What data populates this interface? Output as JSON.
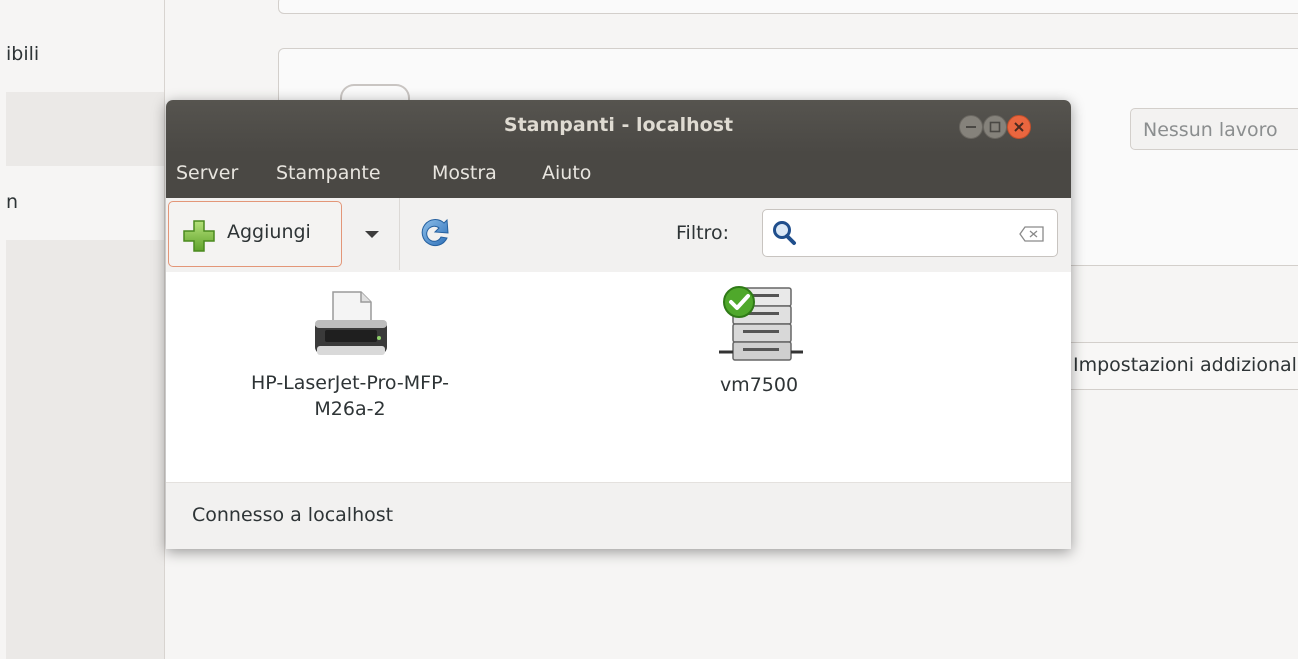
{
  "background": {
    "sidebar_items": [
      "ibili",
      "n"
    ],
    "status_button": "Nessun lavoro",
    "extra_settings_button": "Impostazioni addizionali"
  },
  "dialog": {
    "title": "Stampanti - localhost",
    "menu": [
      "Server",
      "Stampante",
      "Mostra",
      "Aiuto"
    ],
    "toolbar": {
      "add_label": "Aggiungi",
      "filter_label": "Filtro:",
      "filter_value": ""
    },
    "printers": [
      {
        "name_line1": "HP-LaserJet-Pro-MFP-",
        "name_line2": "M26a-2",
        "icon": "printer-icon"
      },
      {
        "name_line1": "vm7500",
        "name_line2": "",
        "icon": "network-printer-default-icon"
      }
    ],
    "status": "Connesso a localhost"
  },
  "colors": {
    "titlebar": "#4a4844",
    "close_button": "#e9663f",
    "accent_border": "#e39678"
  }
}
